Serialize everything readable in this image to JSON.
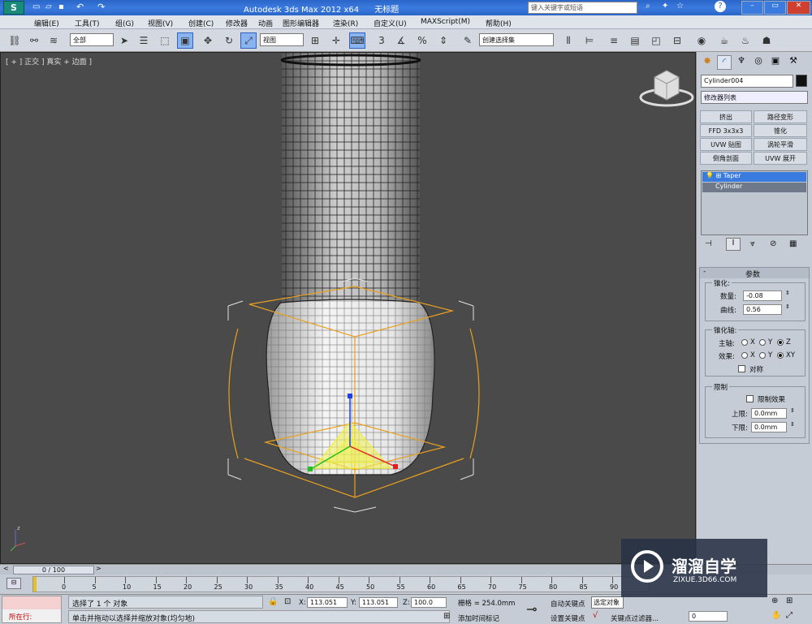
{
  "titlebar": {
    "app_title": "Autodesk 3ds Max  2012 x64",
    "doc_title": "无标题",
    "search_placeholder": "键入关键字或短语"
  },
  "menu": [
    "编辑(E)",
    "工具(T)",
    "组(G)",
    "视图(V)",
    "创建(C)",
    "修改器",
    "动画",
    "图形编辑器",
    "渲染(R)",
    "自定义(U)",
    "MAXScript(M)",
    "帮助(H)"
  ],
  "toolbar": {
    "selection_filter": "全部",
    "ref_coord": "视图",
    "named_selection": "创建选择集",
    "snap_3": "3",
    "snap_25": "2.5",
    "percent_snap": "%",
    "abc": "ABC"
  },
  "viewport": {
    "label": "[ + ] 正交 ] 真实 + 边面 ]"
  },
  "command_panel": {
    "object_name": "Cylinder004",
    "modifier_list": "修改器列表",
    "buttons": [
      "挤出",
      "路径变形",
      "FFD 3x3x3",
      "锥化",
      "UVW 贴图",
      "涡轮平滑",
      "倒角剖面",
      "UVW 展开"
    ],
    "stack": [
      "Taper",
      "Cylinder"
    ],
    "params_title": "参数",
    "taper_group": "锥化:",
    "amount_label": "数量:",
    "amount_value": "-0.08",
    "curve_label": "曲线:",
    "curve_value": "0.56",
    "axis_group": "锥化轴:",
    "primary_label": "主轴:",
    "effect_label": "效果:",
    "x": "X",
    "y": "Y",
    "z": "Z",
    "xy": "XY",
    "symmetry": "对称",
    "limits_group": "限制",
    "limit_effect": "限制效果",
    "upper_label": "上限:",
    "upper_value": "0.0mm",
    "lower_label": "下限:",
    "lower_value": "0.0mm"
  },
  "timeline": {
    "frame_label": "0 / 100",
    "ticks": [
      "0",
      "5",
      "10",
      "15",
      "20",
      "25",
      "30",
      "35",
      "40",
      "45",
      "50",
      "55",
      "60",
      "65",
      "70",
      "75",
      "80",
      "85",
      "90"
    ]
  },
  "status": {
    "running": "所在行:",
    "selected": "选择了 1 个 对象",
    "hint": "单击并拖动以选择并缩放对象(均匀地)",
    "x_label": "X:",
    "x_value": "113.051",
    "y_label": "Y:",
    "y_value": "113.051",
    "z_label": "Z:",
    "z_value": "100.0",
    "grid": "栅格 = 254.0mm",
    "add_time_tag": "添加时间标记",
    "auto_key": "自动关键点",
    "set_key": "设置关键点",
    "selected_obj": "选定对象",
    "key_filters": "关键点过滤器...",
    "frame_value": "0"
  },
  "watermark": {
    "brand": "溜溜自学",
    "url": "ZIXUE.3D66.COM"
  },
  "colors": {
    "viewport_bg": "#4a4a4a",
    "selection_orange": "#e8a020",
    "stack_highlight": "#3a7be0",
    "titlebar": "#2a65c8"
  }
}
